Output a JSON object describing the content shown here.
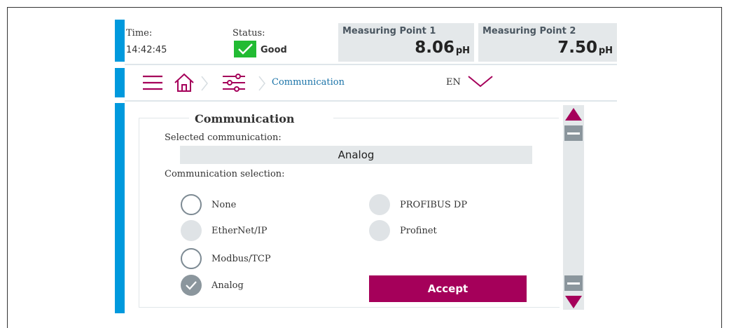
{
  "header": {
    "time_label": "Time:",
    "time_value": "14:42:45",
    "status_label": "Status:",
    "status_value": "Good",
    "status_color": "#22bb33"
  },
  "measuring_points": [
    {
      "title": "Measuring Point 1",
      "value": "8.06",
      "unit": "pH"
    },
    {
      "title": "Measuring Point 2",
      "value": "7.50",
      "unit": "pH"
    }
  ],
  "navbar": {
    "menu_icon": "hamburger-icon",
    "home_icon": "home-icon",
    "settings_icon": "sliders-icon",
    "breadcrumb": "Communication",
    "language": "EN"
  },
  "panel": {
    "title": "Communication",
    "selected_label": "Selected communication:",
    "selected_value": "Analog",
    "selection_label": "Communication selection:",
    "options": [
      {
        "label": "None",
        "state": "empty"
      },
      {
        "label": "EtherNet/IP",
        "state": "disabled"
      },
      {
        "label": "Modbus/TCP",
        "state": "empty"
      },
      {
        "label": "Analog",
        "state": "checked"
      },
      {
        "label": "PROFIBUS DP",
        "state": "disabled"
      },
      {
        "label": "Profinet",
        "state": "disabled"
      }
    ],
    "accept_label": "Accept"
  },
  "colors": {
    "accent_blue": "#0099dd",
    "brand_magenta": "#a5005a"
  }
}
